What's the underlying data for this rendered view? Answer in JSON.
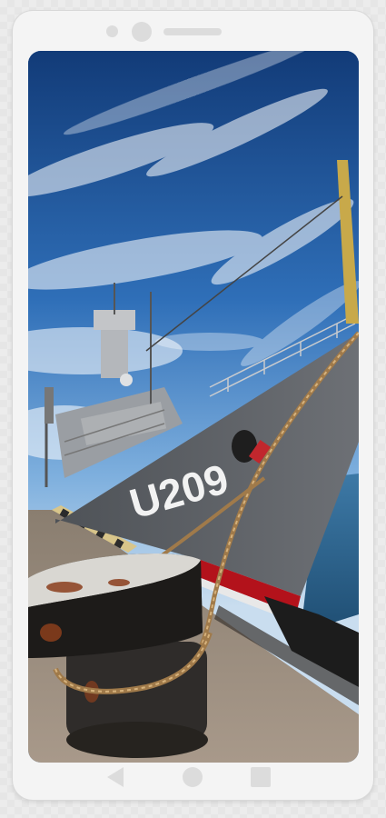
{
  "wallpaper": {
    "hull_number": "U209",
    "sky_color": "#2a5ea8",
    "hull_color": "#5d6064",
    "waterline_color": "#b3121b"
  },
  "icons": {
    "back": "back-triangle-icon",
    "home": "home-circle-icon",
    "recents": "recents-square-icon"
  }
}
